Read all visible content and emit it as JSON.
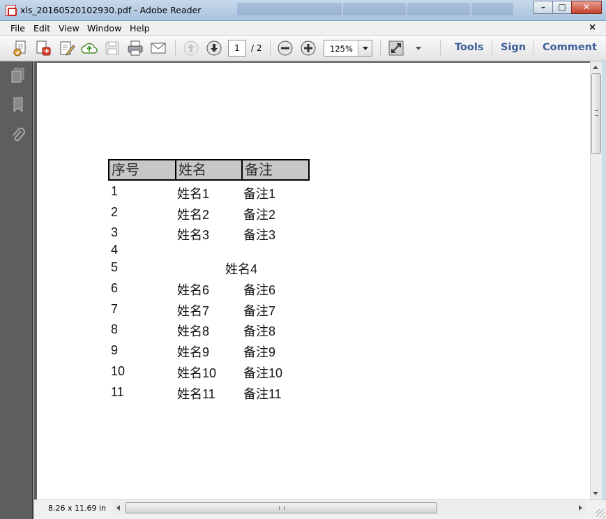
{
  "window": {
    "title": "xls_20160520102930.pdf - Adobe Reader",
    "buttons": {
      "minimize": "–",
      "maximize": "□",
      "close": "✕"
    }
  },
  "menu": {
    "items": [
      "File",
      "Edit",
      "View",
      "Window",
      "Help"
    ],
    "close_document": "×"
  },
  "toolbar": {
    "icons": [
      "create-pdf-icon",
      "share-icon",
      "edit-icon",
      "cloud-upload-icon",
      "save-icon",
      "print-icon",
      "email-icon",
      "previous-page-icon",
      "next-page-icon",
      "zoom-out-icon",
      "zoom-in-icon",
      "fit-page-icon",
      "more-tools-icon"
    ],
    "page_current": "1",
    "page_total": "/ 2",
    "zoom_value": "125%",
    "links": {
      "tools": "Tools",
      "sign": "Sign",
      "comment": "Comment"
    }
  },
  "navigation_pane": {
    "icons": [
      "pages-icon",
      "bookmark-icon",
      "attachment-icon"
    ]
  },
  "document": {
    "headers": [
      "序号",
      "姓名",
      "备注"
    ],
    "rows": [
      [
        "1",
        "姓名1",
        "备注1"
      ],
      [
        "2",
        "姓名2",
        "备注2"
      ],
      [
        "3",
        "姓名3",
        "备注3"
      ],
      [
        "4",
        "",
        ""
      ],
      [
        "5",
        "姓名4",
        ""
      ],
      [
        "6",
        "姓名6",
        "备注6"
      ],
      [
        "7",
        "姓名7",
        "备注7"
      ],
      [
        "8",
        "姓名8",
        "备注8"
      ],
      [
        "9",
        "姓名9",
        "备注9"
      ],
      [
        "10",
        "姓名10",
        "备注10"
      ],
      [
        "11",
        "姓名11",
        "备注11"
      ]
    ]
  },
  "status": {
    "page_size": "8.26 x 11.69 in"
  }
}
